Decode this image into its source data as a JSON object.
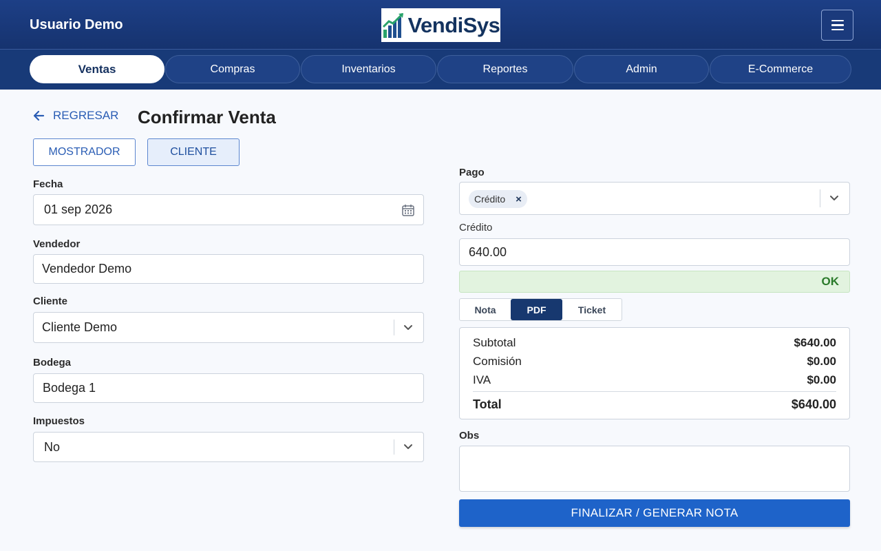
{
  "header": {
    "user_name": "Usuario Demo",
    "logo_text": "VendiSys",
    "menu_icon": "hamburger-menu-icon"
  },
  "nav": {
    "tabs": [
      {
        "label": "Ventas",
        "active": true
      },
      {
        "label": "Compras",
        "active": false
      },
      {
        "label": "Inventarios",
        "active": false
      },
      {
        "label": "Reportes",
        "active": false
      },
      {
        "label": "Admin",
        "active": false
      },
      {
        "label": "E-Commerce",
        "active": false
      }
    ]
  },
  "page": {
    "back_label": "REGRESAR",
    "title": "Confirmar Venta"
  },
  "mode": {
    "mostrador_label": "MOSTRADOR",
    "cliente_label": "CLIENTE",
    "selected": "CLIENTE"
  },
  "form": {
    "fecha": {
      "label": "Fecha",
      "value": "01 sep 2026"
    },
    "vendedor": {
      "label": "Vendedor",
      "value": "Vendedor Demo"
    },
    "cliente": {
      "label": "Cliente",
      "value": "Cliente Demo"
    },
    "bodega": {
      "label": "Bodega",
      "value": "Bodega 1"
    },
    "impuestos": {
      "label": "Impuestos",
      "value": "No"
    }
  },
  "payment": {
    "pago_label": "Pago",
    "pago_chip": "Crédito",
    "chip_remove": "×",
    "credito_label": "Crédito",
    "credito_value": "640.00",
    "status": "OK"
  },
  "output_format": {
    "options": [
      "Nota",
      "PDF",
      "Ticket"
    ],
    "selected": "PDF"
  },
  "summary": {
    "subtotal_label": "Subtotal",
    "subtotal_value": "$640.00",
    "comision_label": "Comisión",
    "comision_value": "$0.00",
    "iva_label": "IVA",
    "iva_value": "$0.00",
    "total_label": "Total",
    "total_value": "$640.00"
  },
  "obs": {
    "label": "Obs",
    "value": ""
  },
  "submit_label": "FINALIZAR / GENERAR NOTA",
  "colors": {
    "header_bg": "#1d3f86",
    "nav_bg": "#183a78",
    "accent": "#1e63c9",
    "ok_bg": "#e2f3df",
    "ok_text": "#2a7a2a"
  }
}
